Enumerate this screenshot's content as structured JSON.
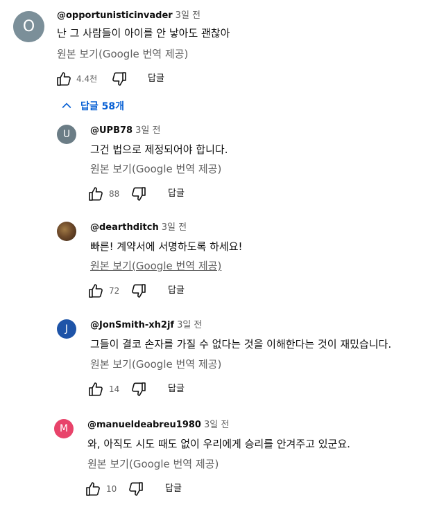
{
  "ui": {
    "translate_label": "원본 보기(Google 번역 제공)",
    "reply_label": "답글",
    "replies_toggle_label": "답글 58개"
  },
  "main_comment": {
    "avatar_letter": "O",
    "avatar_color": "#7b8f99",
    "handle": "@opportunisticinvader",
    "time": "3일 전",
    "text": "난 그 사람들이 아이를 안 낳아도 괜찮아",
    "likes": "4.4천"
  },
  "replies": [
    {
      "avatar_letter": "U",
      "avatar_color": "#6b7d86",
      "handle": "@UPB78",
      "time": "3일 전",
      "text": "그건 법으로 제정되어야 합니다.",
      "likes": "88"
    },
    {
      "avatar_letter": "",
      "avatar_color": "#6e4a2a",
      "handle": "@dearthditch",
      "time": "3일 전",
      "text": "빠른! 계약서에 서명하도록 하세요!",
      "likes": "72"
    },
    {
      "avatar_letter": "J",
      "avatar_color": "#1e54a8",
      "handle": "@JonSmith-xh2jf",
      "time": "3일 전",
      "text": "그들이 결코 손자를 가질 수 없다는 것을 이해한다는 것이 재밌습니다.",
      "likes": "14"
    },
    {
      "avatar_letter": "M",
      "avatar_color": "#e8436a",
      "handle": "@manueldeabreu1980",
      "time": "3일 전",
      "text": "와, 아직도 시도 때도 없이 우리에게 승리를 안겨주고 있군요.",
      "likes": "10"
    }
  ]
}
